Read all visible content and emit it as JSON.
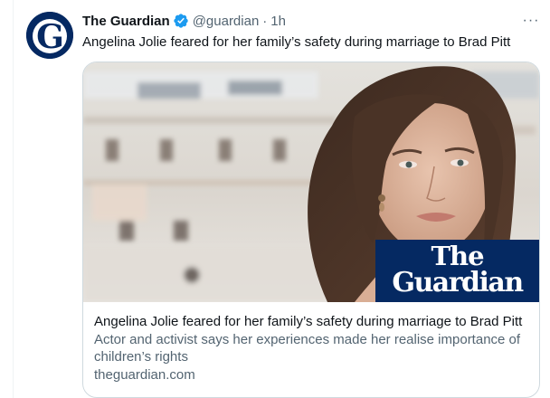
{
  "tweet": {
    "author_name": "The Guardian",
    "handle": "@guardian",
    "separator": "·",
    "time": "1h",
    "text": "Angelina Jolie feared for her family’s safety during marriage to Brad Pitt",
    "more_label": "···",
    "avatar_letter": "G"
  },
  "card": {
    "logo_line1": "The",
    "logo_line2": "Guardian",
    "title": "Angelina Jolie feared for her family’s safety during marriage to Brad Pitt",
    "description": "Actor and activist says her experiences made her realise importance of children’s rights",
    "domain": "theguardian.com"
  },
  "colors": {
    "guardian_blue": "#052962",
    "verified_blue": "#1d9bf0",
    "secondary_text": "#536471",
    "primary_text": "#0f1419",
    "border": "#cfd9de"
  },
  "icons": {
    "verified": "verified-badge-icon",
    "more": "more-options-icon"
  }
}
